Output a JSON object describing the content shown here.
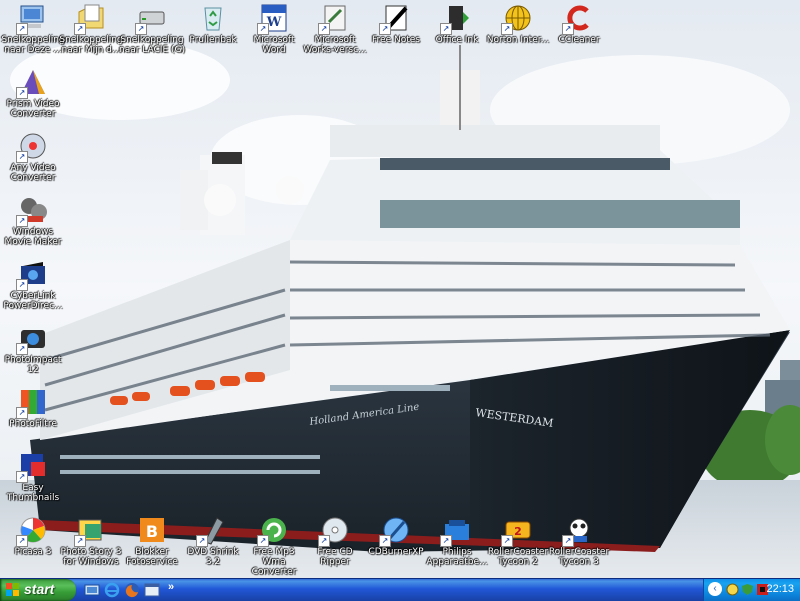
{
  "desktop": {
    "icons_top": [
      {
        "label": "Snelkoppeling naar Deze ...",
        "icon": "my-computer-icon"
      },
      {
        "label": "Snelkoppeling naar Mijn d...",
        "icon": "my-documents-icon"
      },
      {
        "label": "Snelkoppeling naar LACIE (G)",
        "icon": "drive-icon"
      },
      {
        "label": "Prullenbak",
        "icon": "recycle-bin-icon"
      },
      {
        "label": "Microsoft Word",
        "icon": "word-icon"
      },
      {
        "label": "Microsoft Works-versc...",
        "icon": "works-icon"
      },
      {
        "label": "Free Notes",
        "icon": "notes-icon"
      },
      {
        "label": "Office Ink",
        "icon": "office-ink-icon"
      },
      {
        "label": "Norton Inter...",
        "icon": "norton-icon"
      },
      {
        "label": "CCleaner",
        "icon": "ccleaner-icon"
      }
    ],
    "icons_left": [
      {
        "label": "Prism Video Converter",
        "icon": "prism-icon"
      },
      {
        "label": "Any Video Converter",
        "icon": "any-video-icon"
      },
      {
        "label": "Windows Movie Maker",
        "icon": "movie-maker-icon"
      },
      {
        "label": "CyberLink PowerDirec...",
        "icon": "powerdirector-icon"
      },
      {
        "label": "PhotoImpact 12",
        "icon": "photoimpact-icon"
      },
      {
        "label": "PhotoFiltre",
        "icon": "photofiltre-icon"
      },
      {
        "label": "Easy Thumbnails",
        "icon": "easy-thumbnails-icon"
      }
    ],
    "icons_bottom": [
      {
        "label": "Picasa 3",
        "icon": "picasa-icon"
      },
      {
        "label": "Photo Story 3 for Windows",
        "icon": "photo-story-icon"
      },
      {
        "label": "Blokker Fotoservice",
        "icon": "blokker-icon"
      },
      {
        "label": "DVD Shrink 3.2",
        "icon": "dvd-shrink-icon"
      },
      {
        "label": "Free Mp3 Wma Converter",
        "icon": "mp3-converter-icon"
      },
      {
        "label": "Free CD Ripper",
        "icon": "cd-ripper-icon"
      },
      {
        "label": "CDBurnerXP",
        "icon": "cdburner-icon"
      },
      {
        "label": "Philips Apparaatbe...",
        "icon": "philips-icon"
      },
      {
        "label": "RollerCoaster Tycoon 2",
        "icon": "rct2-icon"
      },
      {
        "label": "RollerCoaster Tycoon 3",
        "icon": "rct3-icon"
      }
    ],
    "wallpaper": {
      "ship_name": "WESTERDAM",
      "line_name": "Holland America Line"
    }
  },
  "taskbar": {
    "start_label": "start",
    "more_label": "»",
    "collapse_label": "‹",
    "clock": "22:13"
  }
}
